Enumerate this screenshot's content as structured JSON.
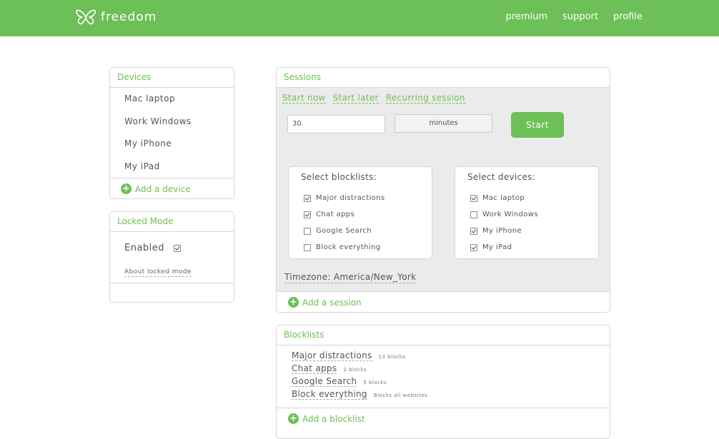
{
  "header": {
    "brand": "freedom",
    "nav": [
      "premium",
      "support",
      "profile"
    ]
  },
  "devices": {
    "title": "Devices",
    "items": [
      "Mac laptop",
      "Work Windows",
      "My iPhone",
      "My iPad"
    ],
    "add_label": "Add a device"
  },
  "locked": {
    "title": "Locked Mode",
    "enabled_label": "Enabled",
    "enabled": true,
    "about_link": "About locked mode"
  },
  "sessions": {
    "title": "Sessions",
    "tabs": [
      "Start now",
      "Start later",
      "Recurring session"
    ],
    "duration_value": "30",
    "unit_selected": "minutes",
    "start_label": "Start",
    "blocklists_title": "Select blocklists:",
    "blocklists": [
      {
        "label": "Major distractions",
        "checked": true
      },
      {
        "label": "Chat apps",
        "checked": true
      },
      {
        "label": "Google Search",
        "checked": false
      },
      {
        "label": "Block everything",
        "checked": false
      }
    ],
    "devices_title": "Select devices:",
    "devices": [
      {
        "label": "Mac laptop",
        "checked": true
      },
      {
        "label": "Work Windows",
        "checked": false
      },
      {
        "label": "My iPhone",
        "checked": true
      },
      {
        "label": "My iPad",
        "checked": true
      }
    ],
    "timezone": "Timezone: America/New_York",
    "add_label": "Add a session"
  },
  "blocklists": {
    "title": "Blocklists",
    "items": [
      {
        "name": "Major distractions",
        "count": "13 blocks"
      },
      {
        "name": "Chat apps",
        "count": "2 blocks"
      },
      {
        "name": "Google Search",
        "count": "5 blocks"
      },
      {
        "name": "Block everything",
        "count": "Blocks all websites"
      }
    ],
    "add_label": "Add a blocklist"
  },
  "colors": {
    "brand_green": "#6dbf57",
    "panel_gray": "#ebebeb"
  }
}
